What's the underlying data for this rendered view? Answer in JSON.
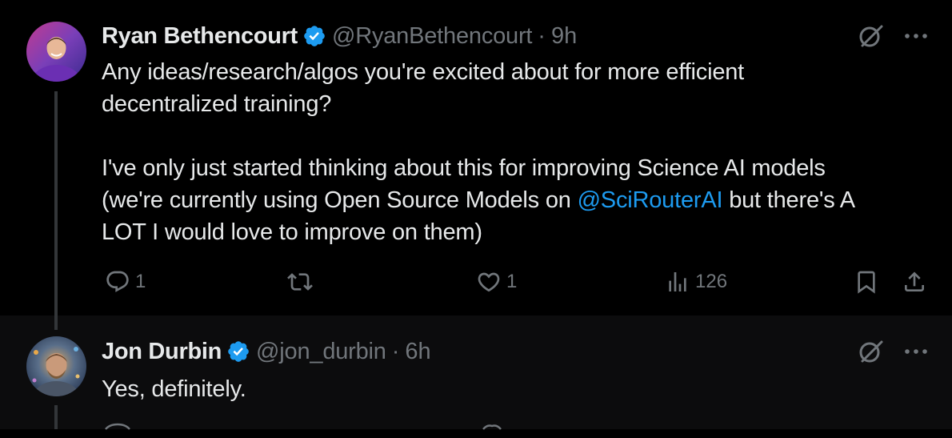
{
  "tweets": [
    {
      "author": {
        "display_name": "Ryan Bethencourt",
        "handle": "@RyanBethencourt",
        "verified": true
      },
      "separator": "·",
      "time": "9h",
      "text_lines_1": [
        "Any ideas/research/algos you're excited about for more efficient",
        "decentralized training?"
      ],
      "text_line_2a": "I've only just started thinking about this for improving Science AI models",
      "text_line_2b_prefix": "(we're currently using Open Source Models on ",
      "mention": "@SciRouterAI",
      "text_line_2b_suffix": " but there's A",
      "text_line_2c": "LOT I would love to improve on them)",
      "actions": {
        "reply_count": "1",
        "retweet_count": "",
        "like_count": "1",
        "views_count": "126"
      }
    },
    {
      "author": {
        "display_name": "Jon Durbin",
        "handle": "@jon_durbin",
        "verified": true
      },
      "separator": "·",
      "time": "6h",
      "text": "Yes, definitely."
    }
  ],
  "colors": {
    "background": "#000000",
    "reply_background": "#0c0c0d",
    "text": "#e7e9ea",
    "secondary": "#71767b",
    "accent": "#1d9bf0"
  },
  "icons": [
    "verified-badge-icon",
    "grok-icon",
    "more-icon",
    "reply-icon",
    "retweet-icon",
    "like-icon",
    "views-icon",
    "bookmark-icon",
    "share-icon"
  ]
}
